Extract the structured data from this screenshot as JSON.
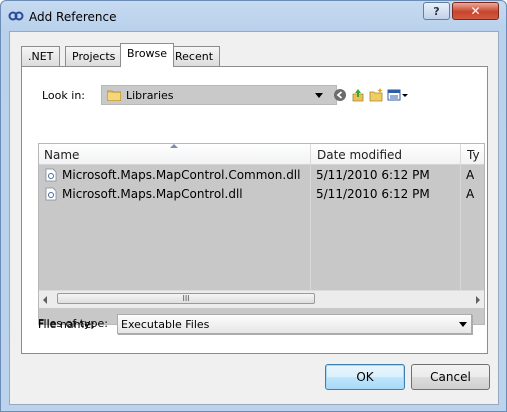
{
  "window": {
    "title": "Add Reference",
    "help_glyph": "?",
    "close_glyph": "✕"
  },
  "tabs": [
    {
      "label": ".NET"
    },
    {
      "label": "Projects"
    },
    {
      "label": "Browse",
      "active": true
    },
    {
      "label": "Recent"
    }
  ],
  "browse": {
    "look_in_label": "Look in:",
    "look_in_value": "Libraries",
    "columns": [
      "Name",
      "Date modified",
      "Ty"
    ],
    "files": [
      {
        "name": "Microsoft.Maps.MapControl.Common.dll",
        "date": "5/11/2010 6:12 PM",
        "type": "A"
      },
      {
        "name": "Microsoft.Maps.MapControl.dll",
        "date": "5/11/2010 6:12 PM",
        "type": "A"
      }
    ],
    "scroll_thumb_grip": "III",
    "file_name_label": "File name:",
    "file_name_value": "",
    "file_type_label": "Files of type:",
    "file_type_value": "Executable Files"
  },
  "buttons": {
    "ok": "OK",
    "cancel": "Cancel"
  },
  "colors": {
    "list_bg": "#c8c8c8",
    "title_bg": "#b9d1ec",
    "close_red": "#c8452c"
  }
}
